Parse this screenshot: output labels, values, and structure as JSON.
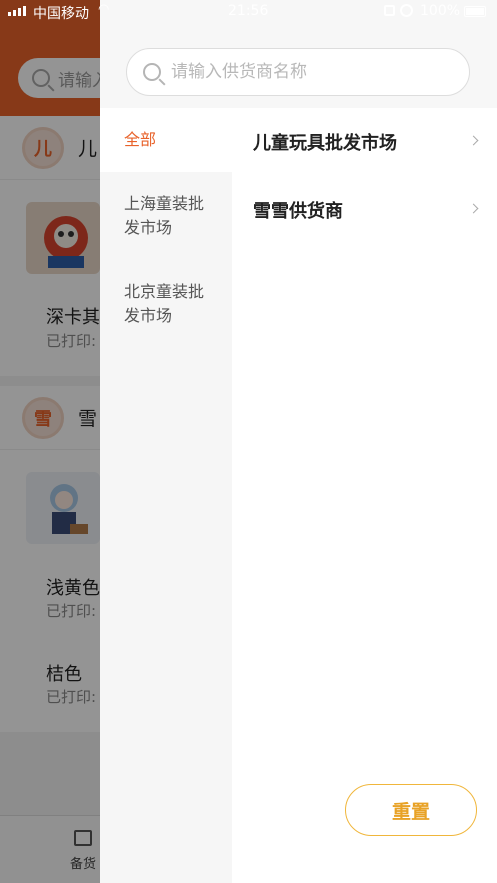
{
  "status_bar": {
    "carrier": "中国移动",
    "time": "21:56",
    "battery": "100%"
  },
  "background_page": {
    "search_placeholder": "请输入",
    "shops": [
      {
        "avatar_char": "儿",
        "name": "儿",
        "products": [
          {
            "name": "深卡其",
            "sub": "已打印:"
          }
        ]
      },
      {
        "avatar_char": "雪",
        "name": "雪",
        "products": [
          {
            "name": "浅黄色",
            "sub": "已打印:"
          },
          {
            "name": "桔色",
            "sub": "已打印:"
          }
        ]
      }
    ],
    "tabbar": {
      "label": "备货"
    }
  },
  "drawer": {
    "search": {
      "placeholder": "请输入供货商名称",
      "value": ""
    },
    "categories": [
      {
        "label": "全部",
        "active": true
      },
      {
        "label": "上海童装批发市场",
        "active": false
      },
      {
        "label": "北京童装批发市场",
        "active": false
      }
    ],
    "suppliers": [
      {
        "label": "儿童玩具批发市场"
      },
      {
        "label": "雪雪供货商"
      }
    ],
    "reset_label": "重置"
  },
  "colors": {
    "accent": "#e8622a",
    "reset_border": "#f0b63b",
    "reset_text": "#e8a226"
  }
}
